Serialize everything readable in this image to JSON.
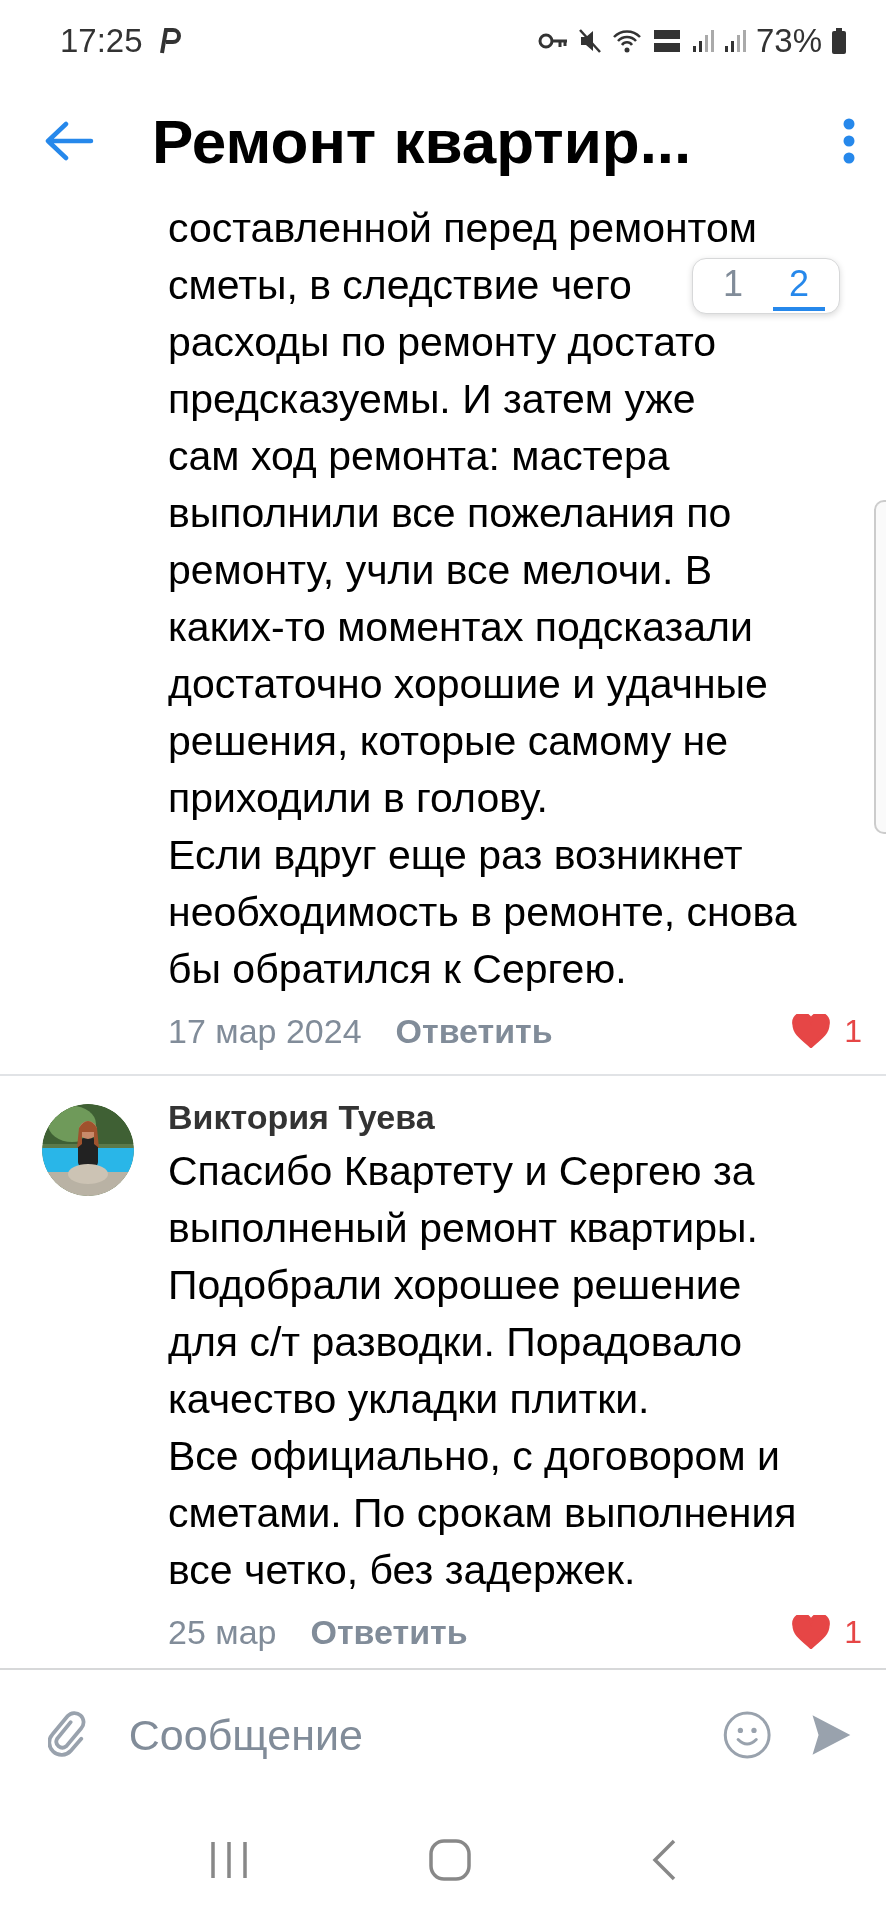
{
  "status_bar": {
    "time": "17:25",
    "battery": "73%"
  },
  "header": {
    "title": "Ремонт квартир..."
  },
  "page_switcher": [
    {
      "label": "1",
      "selected": false
    },
    {
      "label": "2",
      "selected": true
    }
  ],
  "comments": [
    {
      "lines": [
        "составленной перед ремонтом",
        "сметы, в следствие чего",
        "расходы по ремонту достато",
        "предсказуемы. И затем уже",
        "сам ход ремонта: мастера",
        "выполнили все пожелания по",
        "ремонту, учли все мелочи. В",
        "каких-то моментах подсказали",
        "достаточно хорошие и удачные",
        "решения, которые самому не",
        "приходили в голову.",
        "Если вдруг еще раз возникнет",
        "необходимость в ремонте, снова",
        "бы обратился к Сергею."
      ],
      "date": "17 мар 2024",
      "reply": "Ответить",
      "likes": "1",
      "liked": true
    },
    {
      "author": "Виктория Туева",
      "lines": [
        "Спасибо Квартету и Сергею за",
        "выполненый ремонт квартиры.",
        "Подобрали хорошее решение",
        "для с/т разводки. Порадовало",
        "качество укладки плитки.",
        "Все официально, с договором и",
        "сметами. По срокам выполнения",
        "все четко, без задержек."
      ],
      "date": "25 мар",
      "reply": "Ответить",
      "likes": "1",
      "liked": true
    }
  ],
  "composer": {
    "placeholder": "Сообщение"
  }
}
